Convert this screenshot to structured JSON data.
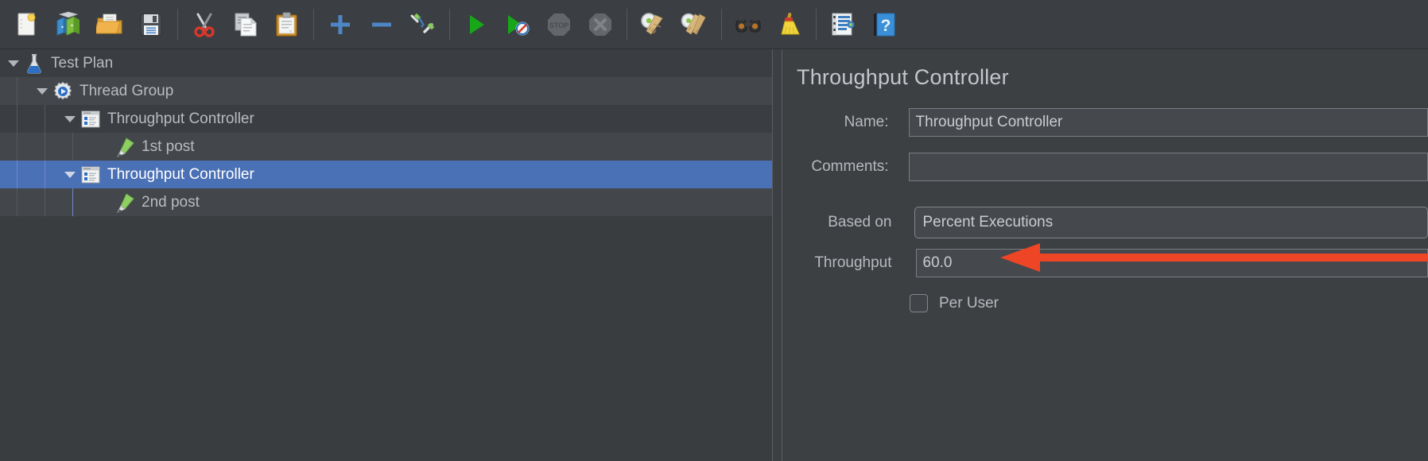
{
  "toolbar": {
    "groups": [
      [
        {
          "name": "new-icon",
          "label": "New",
          "disabled": false
        },
        {
          "name": "templates-icon",
          "label": "Templates",
          "disabled": false
        },
        {
          "name": "open-icon",
          "label": "Open",
          "disabled": false
        },
        {
          "name": "save-icon",
          "label": "Save Test Plan",
          "disabled": false
        }
      ],
      [
        {
          "name": "cut-icon",
          "label": "Cut",
          "disabled": false
        },
        {
          "name": "copy-icon",
          "label": "Copy",
          "disabled": false
        },
        {
          "name": "paste-icon",
          "label": "Paste",
          "disabled": false
        }
      ],
      [
        {
          "name": "expand-all-icon",
          "label": "Expand All",
          "disabled": false
        },
        {
          "name": "collapse-all-icon",
          "label": "Collapse All",
          "disabled": false
        },
        {
          "name": "toggle-icon",
          "label": "Toggle",
          "disabled": false
        }
      ],
      [
        {
          "name": "start-icon",
          "label": "Start",
          "disabled": false
        },
        {
          "name": "start-no-pauses-icon",
          "label": "Start no pauses",
          "disabled": false
        },
        {
          "name": "stop-icon",
          "label": "Stop",
          "disabled": true
        },
        {
          "name": "shutdown-icon",
          "label": "Shutdown",
          "disabled": true
        }
      ],
      [
        {
          "name": "clear-icon",
          "label": "Clear",
          "disabled": false
        },
        {
          "name": "clear-all-icon",
          "label": "Clear All",
          "disabled": false
        }
      ],
      [
        {
          "name": "search-icon",
          "label": "Search",
          "disabled": false
        },
        {
          "name": "reset-search-icon",
          "label": "Reset Search",
          "disabled": false
        }
      ],
      [
        {
          "name": "function-helper-icon",
          "label": "Function Helper Dialog",
          "disabled": false
        },
        {
          "name": "help-icon",
          "label": "Help",
          "disabled": false
        }
      ]
    ]
  },
  "tree": {
    "rows": [
      {
        "label": "Test Plan",
        "depth": 0,
        "icon": "test-plan-icon",
        "twisty": true,
        "selected": false,
        "stripe": "even"
      },
      {
        "label": "Thread Group",
        "depth": 1,
        "icon": "thread-group-icon",
        "twisty": true,
        "selected": false,
        "stripe": "odd"
      },
      {
        "label": "Throughput Controller",
        "depth": 2,
        "icon": "controller-icon",
        "twisty": true,
        "selected": false,
        "stripe": "even"
      },
      {
        "label": "1st post",
        "depth": 3,
        "icon": "http-sampler-icon",
        "twisty": false,
        "selected": false,
        "stripe": "odd"
      },
      {
        "label": "Throughput Controller",
        "depth": 2,
        "icon": "controller-icon",
        "twisty": true,
        "selected": true,
        "stripe": "even"
      },
      {
        "label": "2nd post",
        "depth": 3,
        "icon": "http-sampler-icon",
        "twisty": false,
        "selected": false,
        "stripe": "odd"
      }
    ]
  },
  "panel": {
    "title": "Throughput Controller",
    "name_label": "Name:",
    "name_value": "Throughput Controller",
    "comments_label": "Comments:",
    "comments_value": "",
    "based_on_label": "Based on",
    "based_on_value": "Percent Executions",
    "throughput_label": "Throughput",
    "throughput_value": "60.0",
    "per_user_label": "Per User",
    "per_user_checked": false
  },
  "annotation": {
    "arrow_color": "#ee4526",
    "points_to": "throughput-field"
  }
}
